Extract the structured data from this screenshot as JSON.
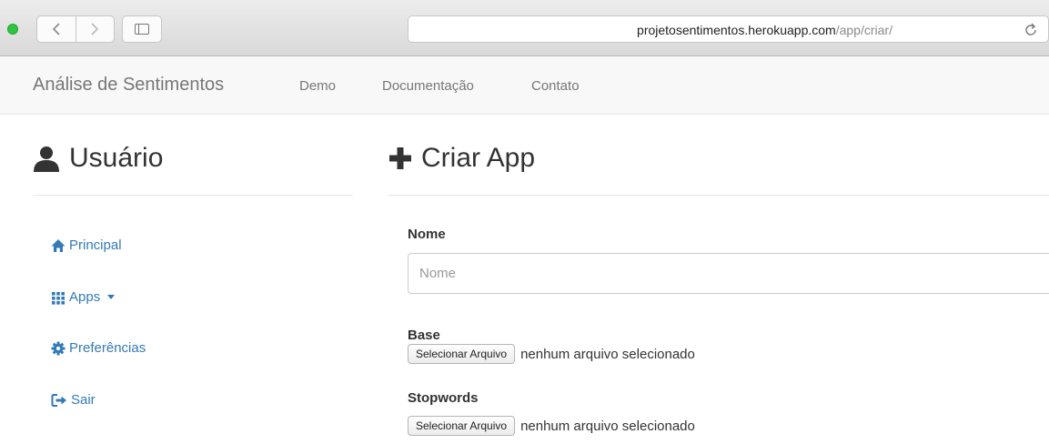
{
  "browser": {
    "url_host": "projetosentimentos.herokuapp.com",
    "url_path": "/app/criar/"
  },
  "site": {
    "brand": "Análise de Sentimentos",
    "nav": [
      "Demo",
      "Documentação",
      "Contato"
    ]
  },
  "sidebar": {
    "heading": "Usuário",
    "items": [
      {
        "label": "Principal",
        "icon": "home-icon"
      },
      {
        "label": "Apps",
        "icon": "grid-icon",
        "dropdown": true
      },
      {
        "label": "Preferências",
        "icon": "gear-icon"
      },
      {
        "label": "Sair",
        "icon": "logout-icon"
      }
    ]
  },
  "main": {
    "heading": "Criar App",
    "fields": {
      "nome": {
        "label": "Nome",
        "placeholder": "Nome",
        "value": ""
      },
      "base": {
        "label": "Base",
        "button": "Selecionar Arquivo",
        "status": "nenhum arquivo selecionado"
      },
      "stopwords": {
        "label": "Stopwords",
        "button": "Selecionar Arquivo",
        "status": "nenhum arquivo selecionado"
      }
    }
  },
  "colors": {
    "link": "#337ab7",
    "traffic_green": "#2fc43f",
    "navbar_bg": "#f8f8f8"
  }
}
